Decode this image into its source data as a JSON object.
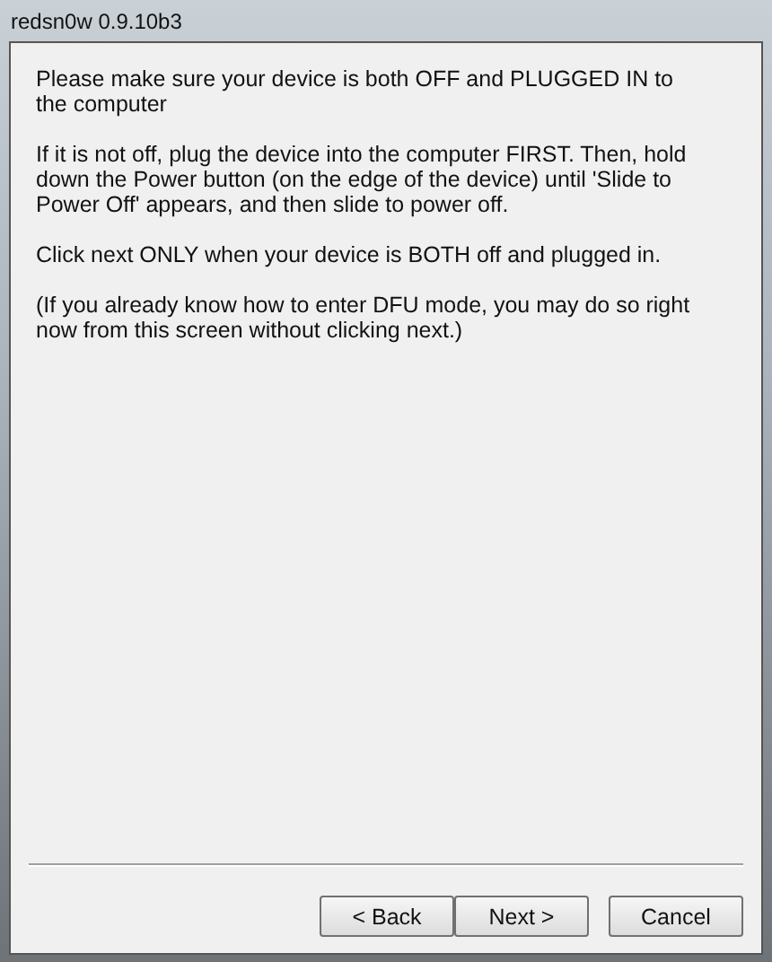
{
  "window": {
    "title": "redsn0w 0.9.10b3"
  },
  "paragraphs": [
    "Please make sure your device is both OFF and PLUGGED IN to the computer",
    "If it is not off, plug the device into the computer FIRST. Then, hold down the Power button (on the edge of the device) until 'Slide to Power Off' appears, and then slide to power off.",
    "Click next ONLY when your device is BOTH off and plugged in.",
    "(If you already know how to enter DFU mode, you may do so right now from this screen without clicking next.)"
  ],
  "buttons": [
    {
      "label": "< Back",
      "kind": "back"
    },
    {
      "label": "Next >",
      "kind": "next"
    },
    {
      "label": "Cancel",
      "kind": "cancel"
    }
  ]
}
